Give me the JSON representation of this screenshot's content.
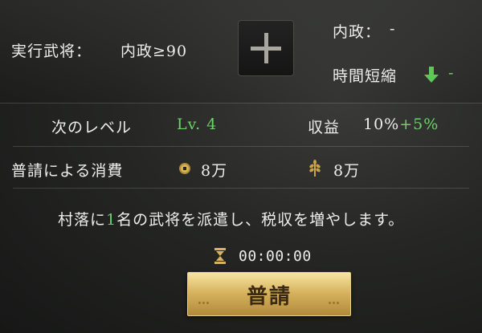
{
  "executor": {
    "label": "実行武将：",
    "requirement": "内政≥90"
  },
  "add_button": {
    "icon": "plus-icon"
  },
  "stats": {
    "domestic_label": "内政：",
    "domestic_value": "-",
    "time_reduction_label": "時間短縮",
    "time_reduction_icon": "arrow-down-icon",
    "time_reduction_value": "-"
  },
  "next_level": {
    "label": "次のレベル",
    "value": "Lv. 4"
  },
  "income": {
    "label": "収益",
    "base": "10%",
    "bonus": "+5%"
  },
  "cost": {
    "label": "普請による消費",
    "gold": {
      "icon": "coin-icon",
      "value": "8万"
    },
    "food": {
      "icon": "wheat-icon",
      "value": "8万"
    }
  },
  "description": {
    "part1": "村落に",
    "count": "1",
    "part2": "名の武将を派遣し、税収を増やします。"
  },
  "timer": {
    "icon": "hourglass-icon",
    "value": "00:00:00"
  },
  "action_button": {
    "label": "普請"
  },
  "colors": {
    "accent_green": "#6cd26a",
    "gold": "#d8b45f"
  }
}
